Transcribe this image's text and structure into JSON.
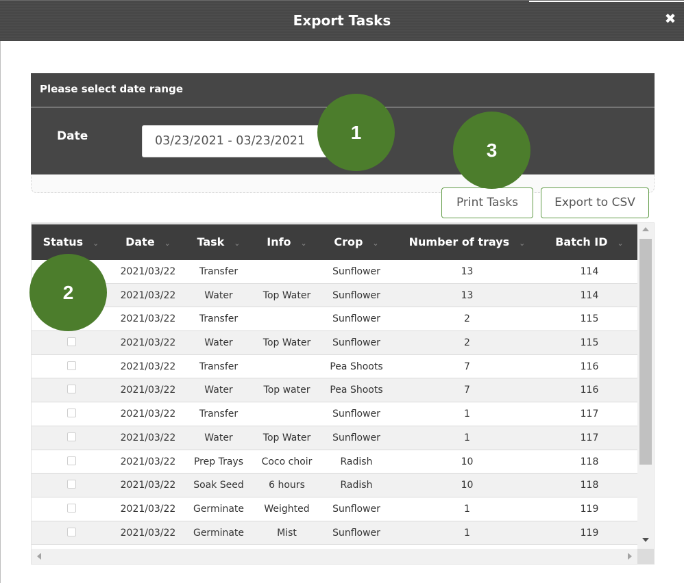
{
  "dialog": {
    "title": "Export Tasks",
    "close_glyph": "✖"
  },
  "date_range": {
    "heading": "Please select date range",
    "date_label": "Date",
    "date_value": "03/23/2021 - 03/23/2021"
  },
  "actions": {
    "print_label": "Print Tasks",
    "csv_label": "Export to CSV"
  },
  "table": {
    "columns": [
      "Status",
      "Date",
      "Task",
      "Info",
      "Crop",
      "Number of trays",
      "Batch ID"
    ],
    "rows": [
      {
        "status": "",
        "date": "2021/03/22",
        "task": "Transfer",
        "info": "",
        "crop": "Sunflower",
        "trays": "13",
        "batch": "114"
      },
      {
        "status": "",
        "date": "2021/03/22",
        "task": "Water",
        "info": "Top Water",
        "crop": "Sunflower",
        "trays": "13",
        "batch": "114"
      },
      {
        "status": "",
        "date": "2021/03/22",
        "task": "Transfer",
        "info": "",
        "crop": "Sunflower",
        "trays": "2",
        "batch": "115"
      },
      {
        "status": "",
        "date": "2021/03/22",
        "task": "Water",
        "info": "Top Water",
        "crop": "Sunflower",
        "trays": "2",
        "batch": "115"
      },
      {
        "status": "",
        "date": "2021/03/22",
        "task": "Transfer",
        "info": "",
        "crop": "Pea Shoots",
        "trays": "7",
        "batch": "116"
      },
      {
        "status": "",
        "date": "2021/03/22",
        "task": "Water",
        "info": "Top water",
        "crop": "Pea Shoots",
        "trays": "7",
        "batch": "116"
      },
      {
        "status": "",
        "date": "2021/03/22",
        "task": "Transfer",
        "info": "",
        "crop": "Sunflower",
        "trays": "1",
        "batch": "117"
      },
      {
        "status": "",
        "date": "2021/03/22",
        "task": "Water",
        "info": "Top Water",
        "crop": "Sunflower",
        "trays": "1",
        "batch": "117"
      },
      {
        "status": "",
        "date": "2021/03/22",
        "task": "Prep Trays",
        "info": "Coco choir",
        "crop": "Radish",
        "trays": "10",
        "batch": "118"
      },
      {
        "status": "",
        "date": "2021/03/22",
        "task": "Soak Seed",
        "info": "6 hours",
        "crop": "Radish",
        "trays": "10",
        "batch": "118"
      },
      {
        "status": "",
        "date": "2021/03/22",
        "task": "Germinate",
        "info": "Weighted",
        "crop": "Sunflower",
        "trays": "1",
        "batch": "119"
      },
      {
        "status": "",
        "date": "2021/03/22",
        "task": "Germinate",
        "info": "Mist",
        "crop": "Sunflower",
        "trays": "1",
        "batch": "119"
      }
    ]
  },
  "markers": {
    "one": "1",
    "two": "2",
    "three": "3"
  },
  "colors": {
    "header_bg": "#3d3d3d",
    "marker": "#4c7d2c",
    "button_border": "#5f9a45"
  }
}
